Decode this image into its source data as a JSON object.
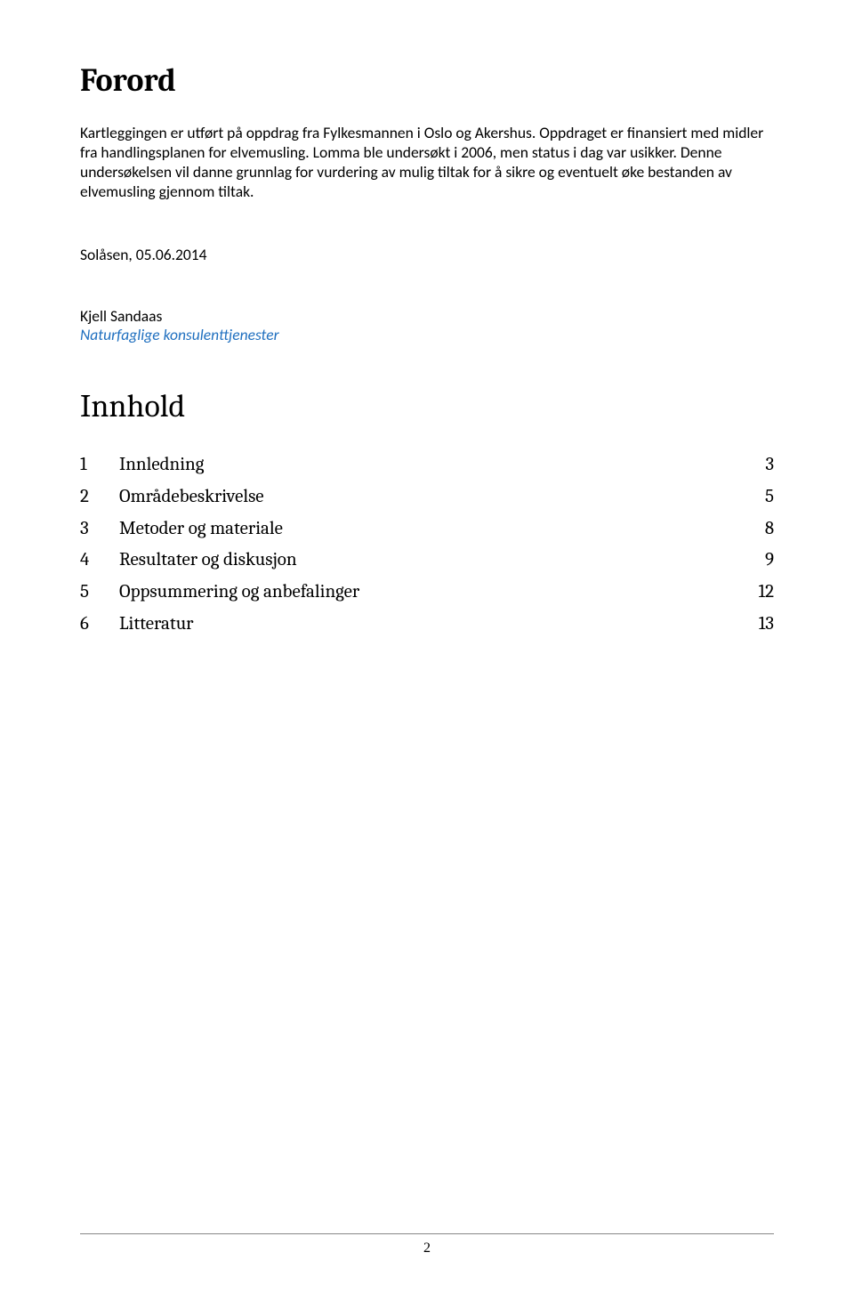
{
  "forord": {
    "heading": "Forord",
    "paragraph": "Kartleggingen er utført på oppdrag fra Fylkesmannen i Oslo og Akershus. Oppdraget er finansiert med midler fra handlingsplanen for elvemusling.  Lomma ble undersøkt i 2006, men status i dag var usikker. Denne undersøkelsen vil danne grunnlag for vurdering av mulig tiltak for å sikre og eventuelt øke bestanden av elvemusling gjennom tiltak.",
    "dateline": "Solåsen, 05.06.2014",
    "author_name": "Kjell Sandaas",
    "author_org": "Naturfaglige konsulenttjenester"
  },
  "innhold": {
    "heading": "Innhold",
    "items": [
      {
        "num": "1",
        "title": "Innledning",
        "page": "3"
      },
      {
        "num": "2",
        "title": "Områdebeskrivelse",
        "page": "5"
      },
      {
        "num": "3",
        "title": "Metoder og materiale",
        "page": "8"
      },
      {
        "num": "4",
        "title": "Resultater og diskusjon",
        "page": "9"
      },
      {
        "num": "5",
        "title": "Oppsummering og anbefalinger",
        "page": "12"
      },
      {
        "num": "6",
        "title": "Litteratur",
        "page": "13"
      }
    ]
  },
  "page_number": "2"
}
